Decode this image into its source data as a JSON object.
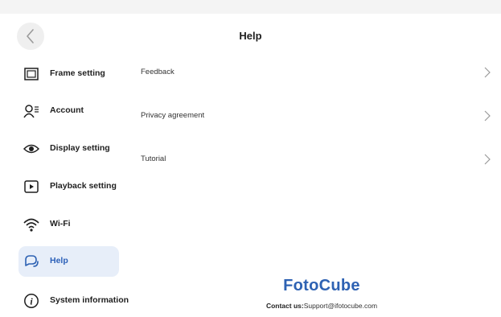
{
  "header": {
    "title": "Help"
  },
  "sidebar": {
    "items": [
      {
        "label": "Frame setting",
        "icon": "frame-icon"
      },
      {
        "label": "Account",
        "icon": "account-icon"
      },
      {
        "label": "Display setting",
        "icon": "eye-icon"
      },
      {
        "label": "Playback setting",
        "icon": "play-icon"
      },
      {
        "label": "Wi-Fi",
        "icon": "wifi-icon"
      },
      {
        "label": "Help",
        "icon": "help-chat-icon",
        "active": true
      },
      {
        "label": "System information",
        "icon": "info-icon"
      }
    ]
  },
  "main": {
    "items": [
      {
        "label": "Feedback"
      },
      {
        "label": "Privacy agreement"
      },
      {
        "label": "Tutorial"
      }
    ]
  },
  "footer": {
    "brand": "FotoCube",
    "contact_label": "Contact us:",
    "contact_email": "Support@ifotocube.com"
  },
  "colors": {
    "accent": "#2e62b3",
    "active_bg": "#e7eef9"
  }
}
